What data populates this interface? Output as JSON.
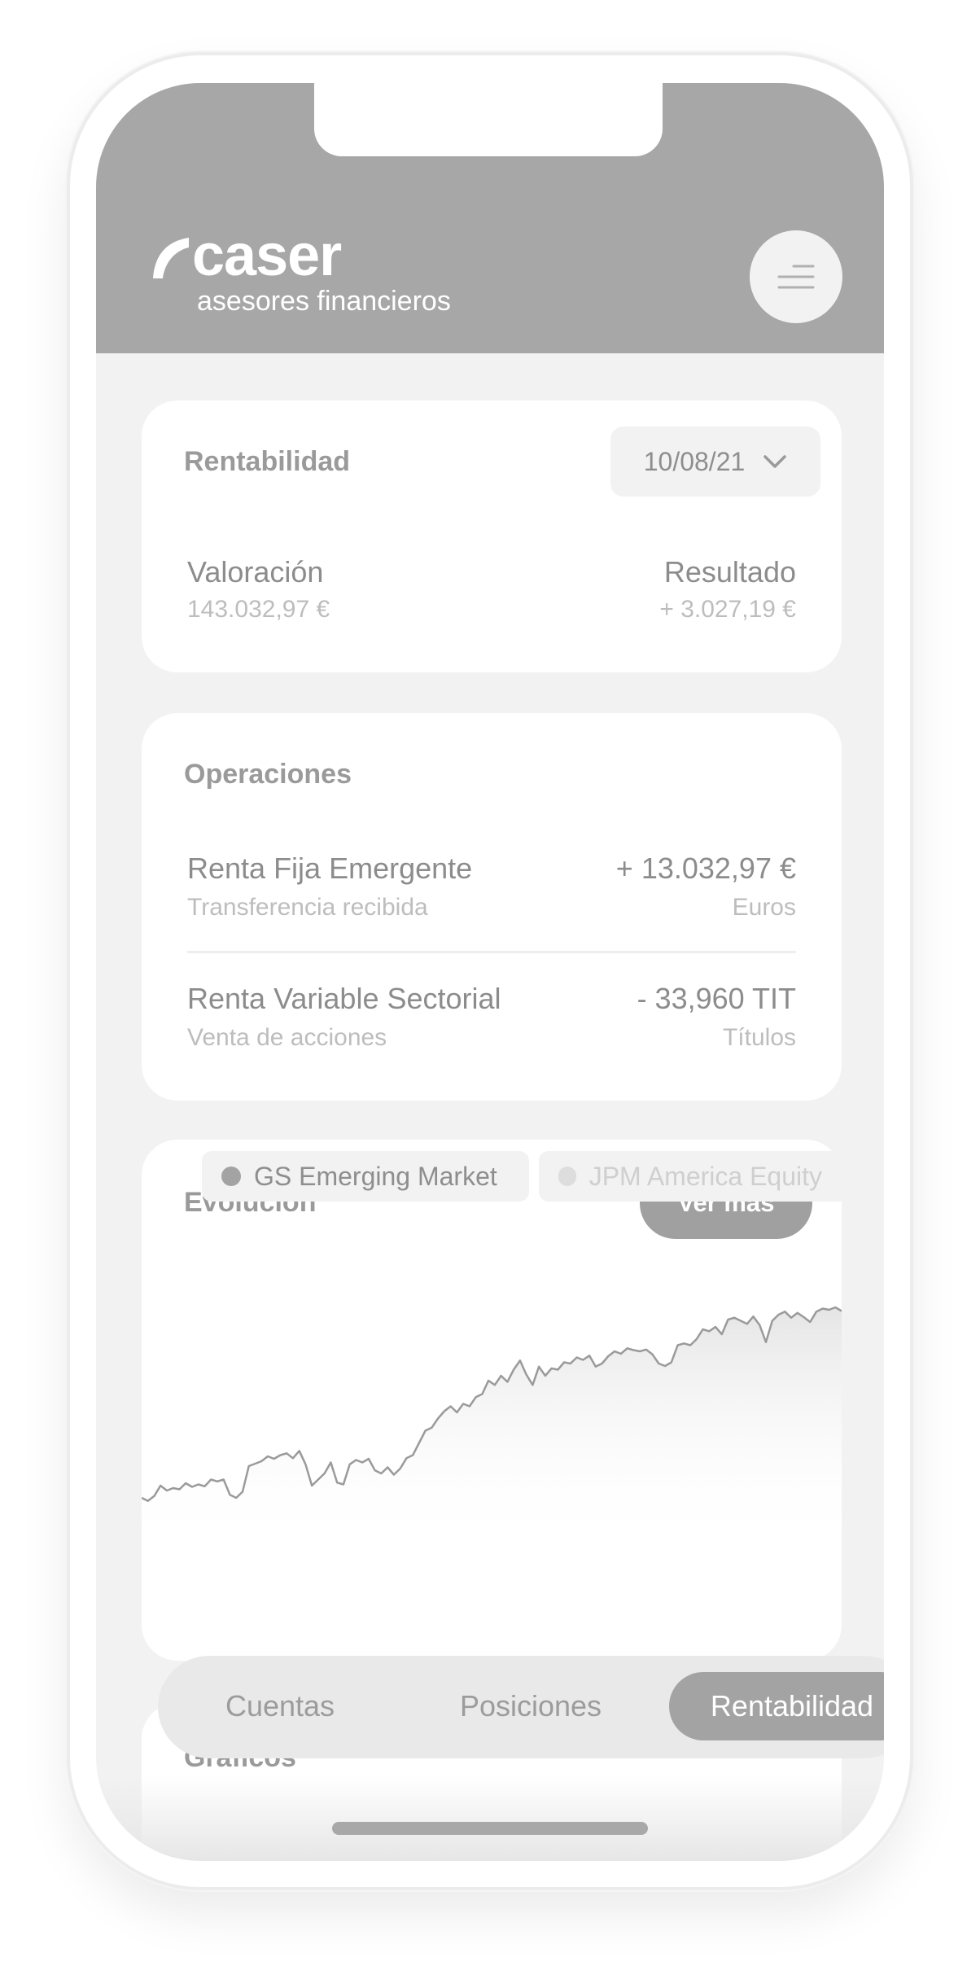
{
  "header": {
    "brand_name": "caser",
    "brand_sub": "asesores financieros",
    "menu_icon": "menu-icon"
  },
  "rentabilidad": {
    "title": "Rentabilidad",
    "date": "10/08/21",
    "valoracion_label": "Valoración",
    "valoracion_value": "143.032,97 €",
    "resultado_label": "Resultado",
    "resultado_value": "+ 3.027,19 €"
  },
  "operaciones": {
    "title": "Operaciones",
    "items": [
      {
        "name": "Renta Fija Emergente",
        "desc": "Transferencia recibida",
        "amount": "+ 13.032,97 €",
        "unit": "Euros"
      },
      {
        "name": "Renta Variable Sectorial",
        "desc": "Venta de acciones",
        "amount": "- 33,960 TIT",
        "unit": "Títulos"
      }
    ]
  },
  "evolucion": {
    "title": "Evolución",
    "more_label": "Ver más",
    "legend": [
      {
        "label": "GS Emerging Market",
        "color": "#a3a3a3",
        "active": true
      },
      {
        "label": "JPM America Equity",
        "color": "#dddddd",
        "active": false
      }
    ]
  },
  "chart_data": {
    "type": "line",
    "series": [
      {
        "name": "GS Emerging Market",
        "values": [
          12.0,
          11.5,
          12.3,
          14.0,
          13.2,
          13.6,
          13.4,
          14.4,
          13.8,
          14.2,
          13.9,
          15.0,
          14.7,
          15.0,
          12.5,
          12.0,
          13.0,
          17.2,
          17.6,
          18.0,
          18.8,
          18.4,
          19.0,
          19.3,
          18.5,
          19.7,
          17.5,
          14.0,
          15.0,
          16.0,
          17.8,
          14.5,
          14.2,
          17.5,
          18.2,
          17.8,
          18.4,
          16.5,
          16.0,
          17.0,
          15.8,
          16.8,
          18.5,
          19.0,
          21.0,
          23.0,
          23.5,
          25.0,
          26.2,
          27.0,
          26.0,
          27.4,
          27.0,
          28.5,
          29.0,
          31.2,
          30.5,
          32.0,
          31.0,
          33.0,
          34.5,
          32.2,
          30.5,
          33.5,
          32.0,
          33.2,
          33.0,
          34.2,
          34.0,
          35.0,
          34.6,
          35.3,
          33.5,
          34.0,
          35.2,
          36.0,
          35.6,
          36.5,
          36.2,
          36.0,
          36.3,
          35.5,
          34.0,
          33.6,
          34.2,
          37.0,
          37.3,
          37.0,
          38.0,
          39.6,
          39.3,
          40.0,
          38.8,
          41.2,
          41.5,
          41.0,
          40.5,
          41.7,
          40.3,
          37.5,
          41.0,
          42.0,
          42.5,
          41.5,
          42.3,
          41.6,
          40.8,
          42.5,
          43.0,
          42.8,
          43.2,
          42.6
        ]
      },
      {
        "name": "JPM America Equity",
        "values": []
      }
    ],
    "ylim": [
      8,
      48
    ],
    "grid": false,
    "legend_position": "bottom"
  },
  "graficos": {
    "title": "Gráficos"
  },
  "tabs": [
    {
      "label": "Cuentas",
      "active": false
    },
    {
      "label": "Posiciones",
      "active": false
    },
    {
      "label": "Rentabilidad",
      "active": true
    }
  ]
}
